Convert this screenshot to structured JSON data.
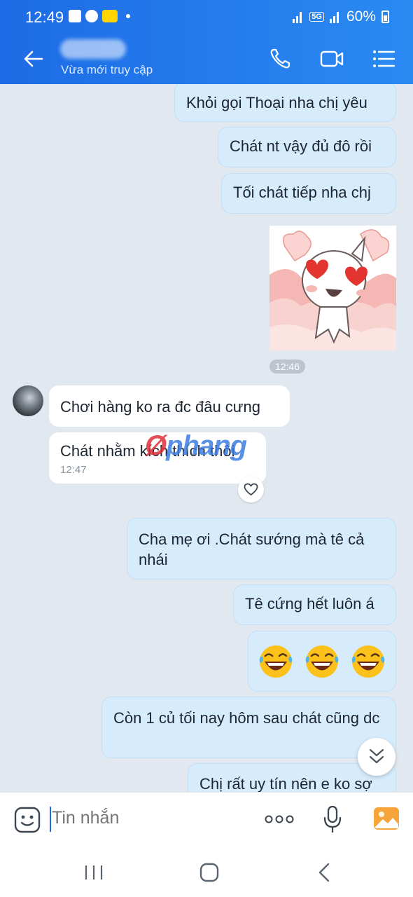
{
  "status": {
    "time": "12:49",
    "network": "5G",
    "battery": "60%"
  },
  "header": {
    "contact_status": "Vừa mới truy cập"
  },
  "messages": {
    "m1": "Khỏi gọi Thoại nha chị yêu",
    "m2": "Chát nt vậy đủ đô rồi",
    "m3": "Tối chát tiếp nha chj",
    "sticker_time": "12:46",
    "m4": "Chơi hàng ko ra đc đâu cưng",
    "m5": "Chát nhằm kích thích thôi",
    "m5_time": "12:47",
    "m6": "Cha mẹ ơi .Chát sướng mà tê cả nhái",
    "m7": "Tê cứng hết luôn á",
    "m9": "Còn 1 củ tối nay hôm sau chát cũng dc",
    "m10": "Chị rất uy tín nên e ko sợ"
  },
  "watermark": {
    "prefix": "Ø",
    "text": "phang"
  },
  "input": {
    "placeholder": "Tin nhắn"
  },
  "colors": {
    "accent": "#1d6be6",
    "outgoing_bubble": "#d6ecfd",
    "incoming_bubble": "#ffffff",
    "chat_bg": "#e2e8f0"
  },
  "icons": {
    "back": "arrow-left-icon",
    "call": "phone-icon",
    "video": "video-camera-icon",
    "menu": "list-menu-icon",
    "reaction": "heart-icon",
    "scroll": "chevron-double-down-icon",
    "emoji": "smiley-icon",
    "more": "more-dots-icon",
    "mic": "microphone-icon",
    "image": "image-icon"
  }
}
